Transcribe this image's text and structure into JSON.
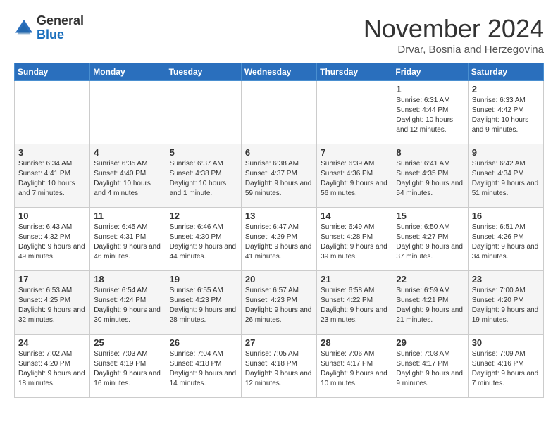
{
  "header": {
    "logo_general": "General",
    "logo_blue": "Blue",
    "month_title": "November 2024",
    "subtitle": "Drvar, Bosnia and Herzegovina"
  },
  "calendar": {
    "days_of_week": [
      "Sunday",
      "Monday",
      "Tuesday",
      "Wednesday",
      "Thursday",
      "Friday",
      "Saturday"
    ],
    "weeks": [
      [
        {
          "day": "",
          "info": ""
        },
        {
          "day": "",
          "info": ""
        },
        {
          "day": "",
          "info": ""
        },
        {
          "day": "",
          "info": ""
        },
        {
          "day": "",
          "info": ""
        },
        {
          "day": "1",
          "info": "Sunrise: 6:31 AM\nSunset: 4:44 PM\nDaylight: 10 hours and 12 minutes."
        },
        {
          "day": "2",
          "info": "Sunrise: 6:33 AM\nSunset: 4:42 PM\nDaylight: 10 hours and 9 minutes."
        }
      ],
      [
        {
          "day": "3",
          "info": "Sunrise: 6:34 AM\nSunset: 4:41 PM\nDaylight: 10 hours and 7 minutes."
        },
        {
          "day": "4",
          "info": "Sunrise: 6:35 AM\nSunset: 4:40 PM\nDaylight: 10 hours and 4 minutes."
        },
        {
          "day": "5",
          "info": "Sunrise: 6:37 AM\nSunset: 4:38 PM\nDaylight: 10 hours and 1 minute."
        },
        {
          "day": "6",
          "info": "Sunrise: 6:38 AM\nSunset: 4:37 PM\nDaylight: 9 hours and 59 minutes."
        },
        {
          "day": "7",
          "info": "Sunrise: 6:39 AM\nSunset: 4:36 PM\nDaylight: 9 hours and 56 minutes."
        },
        {
          "day": "8",
          "info": "Sunrise: 6:41 AM\nSunset: 4:35 PM\nDaylight: 9 hours and 54 minutes."
        },
        {
          "day": "9",
          "info": "Sunrise: 6:42 AM\nSunset: 4:34 PM\nDaylight: 9 hours and 51 minutes."
        }
      ],
      [
        {
          "day": "10",
          "info": "Sunrise: 6:43 AM\nSunset: 4:32 PM\nDaylight: 9 hours and 49 minutes."
        },
        {
          "day": "11",
          "info": "Sunrise: 6:45 AM\nSunset: 4:31 PM\nDaylight: 9 hours and 46 minutes."
        },
        {
          "day": "12",
          "info": "Sunrise: 6:46 AM\nSunset: 4:30 PM\nDaylight: 9 hours and 44 minutes."
        },
        {
          "day": "13",
          "info": "Sunrise: 6:47 AM\nSunset: 4:29 PM\nDaylight: 9 hours and 41 minutes."
        },
        {
          "day": "14",
          "info": "Sunrise: 6:49 AM\nSunset: 4:28 PM\nDaylight: 9 hours and 39 minutes."
        },
        {
          "day": "15",
          "info": "Sunrise: 6:50 AM\nSunset: 4:27 PM\nDaylight: 9 hours and 37 minutes."
        },
        {
          "day": "16",
          "info": "Sunrise: 6:51 AM\nSunset: 4:26 PM\nDaylight: 9 hours and 34 minutes."
        }
      ],
      [
        {
          "day": "17",
          "info": "Sunrise: 6:53 AM\nSunset: 4:25 PM\nDaylight: 9 hours and 32 minutes."
        },
        {
          "day": "18",
          "info": "Sunrise: 6:54 AM\nSunset: 4:24 PM\nDaylight: 9 hours and 30 minutes."
        },
        {
          "day": "19",
          "info": "Sunrise: 6:55 AM\nSunset: 4:23 PM\nDaylight: 9 hours and 28 minutes."
        },
        {
          "day": "20",
          "info": "Sunrise: 6:57 AM\nSunset: 4:23 PM\nDaylight: 9 hours and 26 minutes."
        },
        {
          "day": "21",
          "info": "Sunrise: 6:58 AM\nSunset: 4:22 PM\nDaylight: 9 hours and 23 minutes."
        },
        {
          "day": "22",
          "info": "Sunrise: 6:59 AM\nSunset: 4:21 PM\nDaylight: 9 hours and 21 minutes."
        },
        {
          "day": "23",
          "info": "Sunrise: 7:00 AM\nSunset: 4:20 PM\nDaylight: 9 hours and 19 minutes."
        }
      ],
      [
        {
          "day": "24",
          "info": "Sunrise: 7:02 AM\nSunset: 4:20 PM\nDaylight: 9 hours and 18 minutes."
        },
        {
          "day": "25",
          "info": "Sunrise: 7:03 AM\nSunset: 4:19 PM\nDaylight: 9 hours and 16 minutes."
        },
        {
          "day": "26",
          "info": "Sunrise: 7:04 AM\nSunset: 4:18 PM\nDaylight: 9 hours and 14 minutes."
        },
        {
          "day": "27",
          "info": "Sunrise: 7:05 AM\nSunset: 4:18 PM\nDaylight: 9 hours and 12 minutes."
        },
        {
          "day": "28",
          "info": "Sunrise: 7:06 AM\nSunset: 4:17 PM\nDaylight: 9 hours and 10 minutes."
        },
        {
          "day": "29",
          "info": "Sunrise: 7:08 AM\nSunset: 4:17 PM\nDaylight: 9 hours and 9 minutes."
        },
        {
          "day": "30",
          "info": "Sunrise: 7:09 AM\nSunset: 4:16 PM\nDaylight: 9 hours and 7 minutes."
        }
      ]
    ]
  }
}
